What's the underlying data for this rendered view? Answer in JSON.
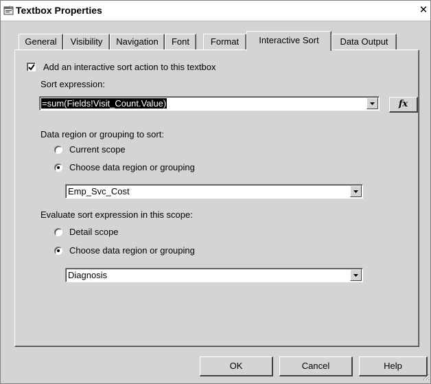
{
  "window": {
    "title": "Textbox Properties",
    "close_glyph": "✕"
  },
  "tabs": [
    {
      "label": "General"
    },
    {
      "label": "Visibility"
    },
    {
      "label": "Navigation"
    },
    {
      "label": "Font"
    },
    {
      "label": "Format"
    },
    {
      "label": "Interactive Sort",
      "active": true
    },
    {
      "label": "Data Output"
    }
  ],
  "interactive_sort": {
    "add_action": {
      "label": "Add an interactive sort action to this textbox",
      "checked": true
    },
    "sort_expression": {
      "label": "Sort expression:",
      "value": "=sum(Fields!Visit_Count.Value)",
      "fx_label": "fx"
    },
    "data_region": {
      "label": "Data region or grouping to sort:",
      "options": [
        {
          "label": "Current scope",
          "selected": false
        },
        {
          "label": "Choose data region or grouping",
          "selected": true
        }
      ],
      "value": "Emp_Svc_Cost"
    },
    "evaluate_scope": {
      "label": "Evaluate sort expression in this scope:",
      "options": [
        {
          "label": "Detail scope",
          "selected": false
        },
        {
          "label": "Choose data region or grouping",
          "selected": true
        }
      ],
      "value": "Diagnosis"
    }
  },
  "buttons": {
    "ok": "OK",
    "cancel": "Cancel",
    "help": "Help"
  },
  "icons": {
    "title": "dialog-properties-icon",
    "close": "close-icon",
    "dropdown": "chevron-down-icon",
    "checkbox": "checkmark-icon",
    "resize": "resize-grip-icon"
  }
}
